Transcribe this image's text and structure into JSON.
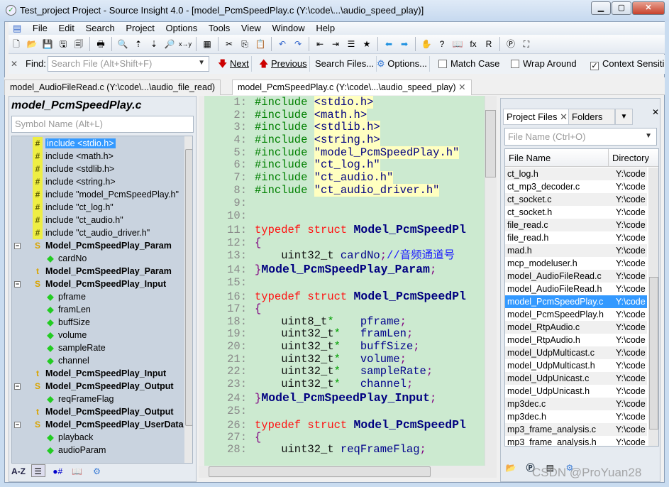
{
  "window": {
    "title": "Test_project Project - Source Insight 4.0 - [model_PcmSpeedPlay.c (Y:\\code\\...\\audio_speed_play)]",
    "controls": [
      "minimize",
      "maximize",
      "close"
    ]
  },
  "menu": [
    "File",
    "Edit",
    "Search",
    "Project",
    "Options",
    "Tools",
    "View",
    "Window",
    "Help"
  ],
  "toolbar_icons": [
    "new-file",
    "open",
    "save",
    "save-as",
    "save-all",
    "print",
    "lookup",
    "jump-up",
    "jump-down",
    "browse",
    "replace",
    "web",
    "cut",
    "copy",
    "paste",
    "undo",
    "redo",
    "go-prev-diff",
    "go-next-diff",
    "outline",
    "bookmark",
    "back",
    "forward",
    "hand",
    "symbol-info",
    "book",
    "function",
    "relation",
    "project",
    "screen"
  ],
  "find": {
    "label": "Find:",
    "placeholder": "Search File (Alt+Shift+F)",
    "next": "Next",
    "previous": "Previous",
    "search_files": "Search Files...",
    "options": "Options...",
    "match_case": "Match Case",
    "match_case_checked": false,
    "wrap_around": "Wrap Around",
    "wrap_around_checked": false,
    "context": "Context Sensiti",
    "context_checked": true
  },
  "tabs": [
    {
      "label": "model_AudioFileRead.c (Y:\\code\\...\\audio_file_read)",
      "active": false
    },
    {
      "label": "model_PcmSpeedPlay.c (Y:\\code\\...\\audio_speed_play)",
      "active": true
    }
  ],
  "symbols": {
    "title": "model_PcmSpeedPlay.c",
    "placeholder": "Symbol Name (Alt+L)",
    "items": [
      {
        "icon": "#",
        "label": "include <stdio.h>",
        "level": 0,
        "selected": true
      },
      {
        "icon": "#",
        "label": "include <math.h>",
        "level": 0
      },
      {
        "icon": "#",
        "label": "include <stdlib.h>",
        "level": 0
      },
      {
        "icon": "#",
        "label": "include <string.h>",
        "level": 0
      },
      {
        "icon": "#",
        "label": "include \"model_PcmSpeedPlay.h\"",
        "level": 0
      },
      {
        "icon": "#",
        "label": "include \"ct_log.h\"",
        "level": 0
      },
      {
        "icon": "#",
        "label": "include \"ct_audio.h\"",
        "level": 0
      },
      {
        "icon": "#",
        "label": "include \"ct_audio_driver.h\"",
        "level": 0
      },
      {
        "icon": "S",
        "label": "Model_PcmSpeedPlay_Param",
        "level": 0,
        "bold": true,
        "expand": true
      },
      {
        "icon": "◆",
        "label": "cardNo",
        "level": 1
      },
      {
        "icon": "t",
        "label": "Model_PcmSpeedPlay_Param",
        "level": 0,
        "bold": true
      },
      {
        "icon": "S",
        "label": "Model_PcmSpeedPlay_Input",
        "level": 0,
        "bold": true,
        "expand": true
      },
      {
        "icon": "◆",
        "label": "pframe",
        "level": 1
      },
      {
        "icon": "◆",
        "label": "framLen",
        "level": 1
      },
      {
        "icon": "◆",
        "label": "buffSize",
        "level": 1
      },
      {
        "icon": "◆",
        "label": "volume",
        "level": 1
      },
      {
        "icon": "◆",
        "label": "sampleRate",
        "level": 1
      },
      {
        "icon": "◆",
        "label": "channel",
        "level": 1
      },
      {
        "icon": "t",
        "label": "Model_PcmSpeedPlay_Input",
        "level": 0,
        "bold": true
      },
      {
        "icon": "S",
        "label": "Model_PcmSpeedPlay_Output",
        "level": 0,
        "bold": true,
        "expand": true
      },
      {
        "icon": "◆",
        "label": "reqFrameFlag",
        "level": 1
      },
      {
        "icon": "t",
        "label": "Model_PcmSpeedPlay_Output",
        "level": 0,
        "bold": true
      },
      {
        "icon": "S",
        "label": "Model_PcmSpeedPlay_UserData",
        "level": 0,
        "bold": true,
        "expand": true
      },
      {
        "icon": "◆",
        "label": "playback",
        "level": 1
      },
      {
        "icon": "◆",
        "label": "audioParam",
        "level": 1
      }
    ],
    "bottom": {
      "sort": "A-Z"
    }
  },
  "code": [
    {
      "n": "1:",
      "s": [
        [
          "pp",
          "#include "
        ],
        [
          "inc",
          "<stdio.h>"
        ]
      ]
    },
    {
      "n": "2:",
      "s": [
        [
          "pp",
          "#include "
        ],
        [
          "inc",
          "<math.h>"
        ]
      ]
    },
    {
      "n": "3:",
      "s": [
        [
          "pp",
          "#include "
        ],
        [
          "inc",
          "<stdlib.h>"
        ]
      ]
    },
    {
      "n": "4:",
      "s": [
        [
          "pp",
          "#include "
        ],
        [
          "inc",
          "<string.h>"
        ]
      ]
    },
    {
      "n": "5:",
      "s": [
        [
          "pp",
          "#include "
        ],
        [
          "inc",
          "\"model_PcmSpeedPlay.h\""
        ]
      ]
    },
    {
      "n": "6:",
      "s": [
        [
          "pp",
          "#include "
        ],
        [
          "inc",
          "\"ct_log.h\""
        ]
      ]
    },
    {
      "n": "7:",
      "s": [
        [
          "pp",
          "#include "
        ],
        [
          "inc",
          "\"ct_audio.h\""
        ]
      ]
    },
    {
      "n": "8:",
      "s": [
        [
          "pp",
          "#include "
        ],
        [
          "inc",
          "\"ct_audio_driver.h\""
        ]
      ]
    },
    {
      "n": "9:",
      "s": []
    },
    {
      "n": "10:",
      "s": [],
      "big": true
    },
    {
      "n": "11:",
      "s": [
        [
          "kw",
          "typedef struct "
        ],
        [
          "tn",
          "Model_PcmSpeedPl"
        ]
      ],
      "big": true
    },
    {
      "n": "12:",
      "s": [
        [
          "pu",
          "{"
        ]
      ],
      "big": true
    },
    {
      "n": "13:",
      "s": [
        [
          "ty",
          "    uint32_t "
        ],
        [
          "vr",
          "cardNo"
        ],
        [
          "pu",
          ";"
        ],
        [
          "cm",
          "//音频通道号"
        ]
      ]
    },
    {
      "n": "14:",
      "s": [
        [
          "pu",
          "}"
        ],
        [
          "tn",
          "Model_PcmSpeedPlay_Param"
        ],
        [
          "pu",
          ";"
        ]
      ],
      "big": true
    },
    {
      "n": "15:",
      "s": [],
      "big": true
    },
    {
      "n": "16:",
      "s": [
        [
          "kw",
          "typedef struct "
        ],
        [
          "tn",
          "Model_PcmSpeedPl"
        ]
      ],
      "big": true
    },
    {
      "n": "17:",
      "s": [
        [
          "pu",
          "{"
        ]
      ]
    },
    {
      "n": "18:",
      "s": [
        [
          "ty",
          "    uint8_t"
        ],
        [
          "st",
          "*"
        ],
        [
          "ty",
          "    "
        ],
        [
          "vr",
          "pframe"
        ],
        [
          "pu",
          ";"
        ]
      ]
    },
    {
      "n": "19:",
      "s": [
        [
          "ty",
          "    uint32_t"
        ],
        [
          "st",
          "*"
        ],
        [
          "ty",
          "   "
        ],
        [
          "vr",
          "framLen"
        ],
        [
          "pu",
          ";"
        ]
      ]
    },
    {
      "n": "20:",
      "s": [
        [
          "ty",
          "    uint32_t"
        ],
        [
          "st",
          "*"
        ],
        [
          "ty",
          "   "
        ],
        [
          "vr",
          "buffSize"
        ],
        [
          "pu",
          ";"
        ]
      ]
    },
    {
      "n": "21:",
      "s": [
        [
          "ty",
          "    uint32_t"
        ],
        [
          "st",
          "*"
        ],
        [
          "ty",
          "   "
        ],
        [
          "vr",
          "volume"
        ],
        [
          "pu",
          ";"
        ]
      ]
    },
    {
      "n": "22:",
      "s": [
        [
          "ty",
          "    uint32_t"
        ],
        [
          "st",
          "*"
        ],
        [
          "ty",
          "   "
        ],
        [
          "vr",
          "sampleRate"
        ],
        [
          "pu",
          ";"
        ]
      ]
    },
    {
      "n": "23:",
      "s": [
        [
          "ty",
          "    uint32_t"
        ],
        [
          "st",
          "*"
        ],
        [
          "ty",
          "   "
        ],
        [
          "vr",
          "channel"
        ],
        [
          "pu",
          ";"
        ]
      ]
    },
    {
      "n": "24:",
      "s": [
        [
          "pu",
          "}"
        ],
        [
          "tn",
          "Model_PcmSpeedPlay_Input"
        ],
        [
          "pu",
          ";"
        ]
      ],
      "big": true
    },
    {
      "n": "25:",
      "s": [],
      "big": true
    },
    {
      "n": "26:",
      "s": [
        [
          "kw",
          "typedef struct "
        ],
        [
          "tn",
          "Model_PcmSpeedPl"
        ]
      ],
      "big": true
    },
    {
      "n": "27:",
      "s": [
        [
          "pu",
          "{"
        ]
      ]
    },
    {
      "n": "28:",
      "s": [
        [
          "ty",
          "    uint32_t "
        ],
        [
          "vr",
          "reqFrameFlag"
        ],
        [
          "pu",
          ";"
        ]
      ]
    }
  ],
  "project": {
    "tabs": [
      {
        "label": "Project Files",
        "active": true,
        "closable": true
      },
      {
        "label": "Folders",
        "active": false
      }
    ],
    "placeholder": "File Name (Ctrl+O)",
    "columns": [
      "File Name",
      "Directory"
    ],
    "files": [
      [
        "ct_log.h",
        "Y:\\code"
      ],
      [
        "ct_mp3_decoder.c",
        "Y:\\code"
      ],
      [
        "ct_socket.c",
        "Y:\\code"
      ],
      [
        "ct_socket.h",
        "Y:\\code"
      ],
      [
        "file_read.c",
        "Y:\\code"
      ],
      [
        "file_read.h",
        "Y:\\code"
      ],
      [
        "mad.h",
        "Y:\\code"
      ],
      [
        "mcp_modeluser.h",
        "Y:\\code"
      ],
      [
        "model_AudioFileRead.c",
        "Y:\\code"
      ],
      [
        "model_AudioFileRead.h",
        "Y:\\code"
      ],
      [
        "model_PcmSpeedPlay.c",
        "Y:\\code"
      ],
      [
        "model_PcmSpeedPlay.h",
        "Y:\\code"
      ],
      [
        "model_RtpAudio.c",
        "Y:\\code"
      ],
      [
        "model_RtpAudio.h",
        "Y:\\code"
      ],
      [
        "model_UdpMulticast.c",
        "Y:\\code"
      ],
      [
        "model_UdpMulticast.h",
        "Y:\\code"
      ],
      [
        "model_UdpUnicast.c",
        "Y:\\code"
      ],
      [
        "model_UdpUnicast.h",
        "Y:\\code"
      ],
      [
        "mp3dec.c",
        "Y:\\code"
      ],
      [
        "mp3dec.h",
        "Y:\\code"
      ],
      [
        "mp3_frame_analysis.c",
        "Y:\\code"
      ],
      [
        "mp3_frame_analysis.h",
        "Y:\\code"
      ]
    ],
    "selected": "model_PcmSpeedPlay.c"
  },
  "watermark": "CSDN @ProYuan28",
  "colors": {
    "editor_bg": "#ccead0",
    "selection": "#3399ff",
    "keyword": "#ff1010",
    "preprocessor": "#008000",
    "type_name": "#000080"
  }
}
